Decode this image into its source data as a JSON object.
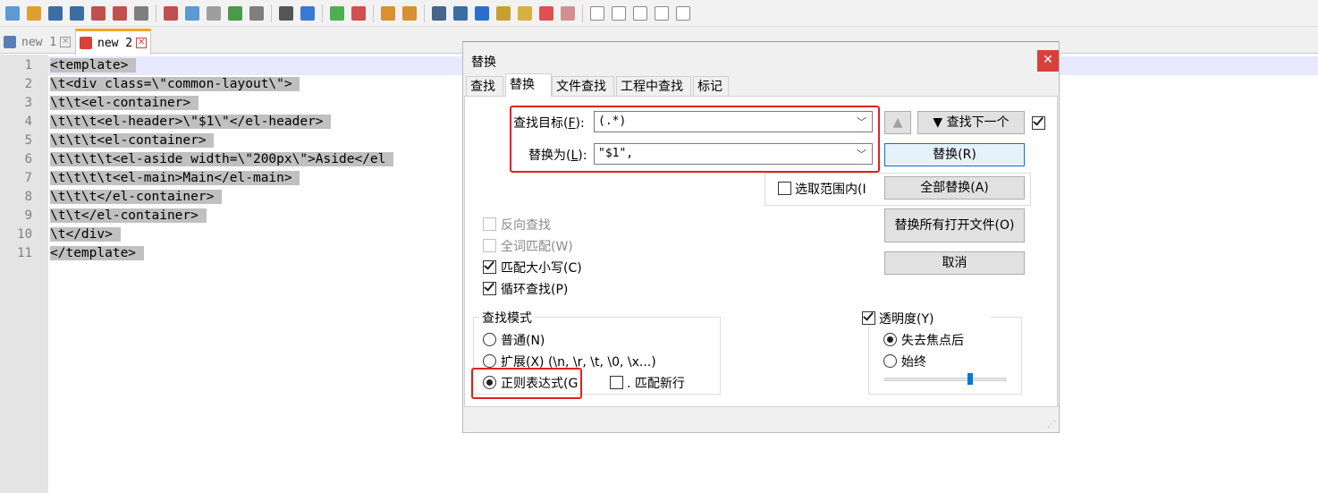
{
  "toolbar": {
    "icons": [
      "new-file",
      "open-file",
      "save",
      "save-all",
      "close",
      "close-all",
      "print",
      "cut",
      "copy",
      "paste",
      "undo",
      "redo",
      "find",
      "replace",
      "zoom-in",
      "zoom-out",
      "sync-v",
      "sync-h",
      "word-wrap",
      "show-all",
      "indent-guide",
      "doc-map",
      "function-list",
      "folder-workspace",
      "monitor",
      "record",
      "stop",
      "play",
      "run-multiple",
      "save-macro"
    ]
  },
  "tabs": [
    {
      "label": "new 1",
      "close": "✕"
    },
    {
      "label": "new 2",
      "close": "✕"
    }
  ],
  "editor": {
    "line_numbers": [
      "1",
      "2",
      "3",
      "4",
      "5",
      "6",
      "7",
      "8",
      "9",
      "10",
      "11"
    ],
    "lines": [
      "<template>",
      "\\t<div class=\\\"common-layout\\\">",
      "\\t\\t<el-container>",
      "\\t\\t\\t<el-header>\\\"$1\\\"</el-header>",
      "\\t\\t\\t<el-container>",
      "\\t\\t\\t\\t<el-aside width=\\\"200px\\\">Aside</el",
      "\\t\\t\\t\\t<el-main>Main</el-main>",
      "\\t\\t\\t</el-container>",
      "\\t\\t</el-container>",
      "\\t</div>",
      "</template>"
    ]
  },
  "dialog": {
    "title": "替换",
    "close": "✕",
    "tabs": [
      "查找",
      "替换",
      "文件查找",
      "工程中查找",
      "标记"
    ],
    "find_label": "查找目标(",
    "find_key": "F",
    "find_value": "(.*)",
    "replace_label": "替换为(",
    "replace_key": "L",
    "replace_value": "\"$1\",",
    "label_suffix": "):",
    "find_prev": "▲",
    "find_next": "▼ 查找下一个",
    "btn_replace": "替换(R)",
    "btn_replace_all": "全部替换(A)",
    "btn_replace_all_open": "替换所有打开文件(O)",
    "btn_cancel": "取消",
    "in_selection": "选取范围内(I",
    "opt_backward": "反向查找",
    "opt_whole_word": "全词匹配(W)",
    "opt_match_case": "匹配大小写(C)",
    "opt_wrap": "循环查找(P)",
    "mode_title": "查找模式",
    "mode_normal": "普通(N)",
    "mode_extended": "扩展(X) (\\n, \\r, \\t, \\0, \\x...)",
    "mode_regex": "正则表达式(G",
    "dot_newline": ". 匹配新行",
    "transparency": "透明度(Y)",
    "trans_lose_focus": "失去焦点后",
    "trans_always": "始终"
  }
}
